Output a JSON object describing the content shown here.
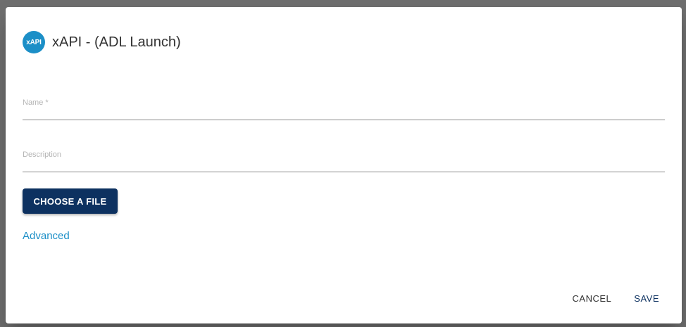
{
  "dialog": {
    "logo_text": "xAPI",
    "title": "xAPI - (ADL Launch)",
    "name_label": "Name *",
    "name_value": "",
    "description_label": "Description",
    "description_value": "",
    "choose_file_label": "CHOOSE A FILE",
    "advanced_label": "Advanced",
    "cancel_label": "CANCEL",
    "save_label": "SAVE"
  },
  "colors": {
    "accent": "#1c8fc7",
    "primary_button": "#0d3160",
    "backdrop": "#6e6e6e"
  }
}
